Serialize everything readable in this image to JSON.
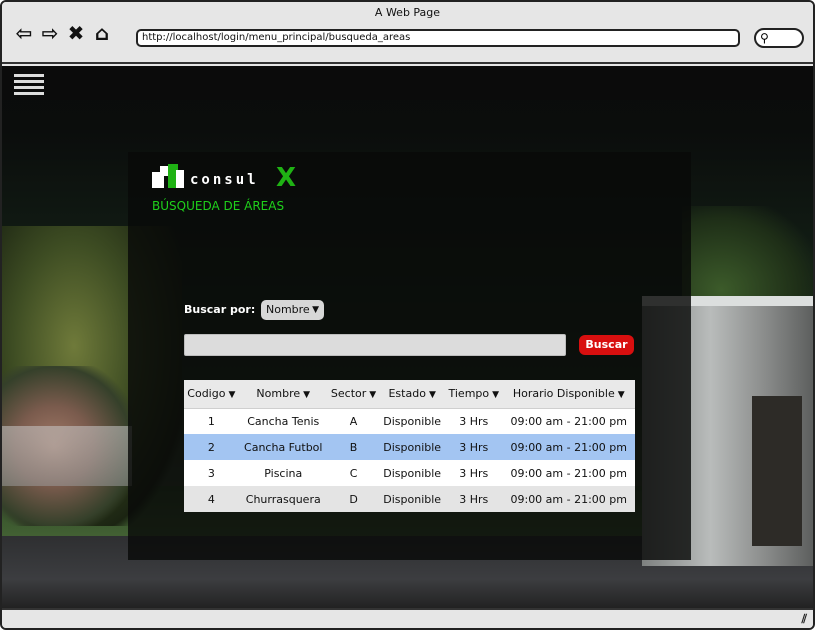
{
  "window": {
    "title": "A Web Page",
    "url": "http://localhost/login/menu_principal/busqueda_areas"
  },
  "icons": {
    "back": "back-arrow-icon",
    "forward": "forward-arrow-icon",
    "close": "close-icon",
    "home": "home-icon",
    "search": "search-icon",
    "menu": "hamburger-menu-icon",
    "resize": "resize-grip-icon"
  },
  "brand": {
    "logo_text": "consul",
    "logo_x": "X",
    "accent_color": "#1fb214"
  },
  "page": {
    "heading": "BÚSQUEDA DE ÁREAS"
  },
  "search": {
    "label": "Buscar por:",
    "filter_selected": "Nombre",
    "input_value": "",
    "button_label": "Buscar",
    "button_color": "#d80f0f"
  },
  "table": {
    "columns": [
      "Codigo",
      "Nombre",
      "Sector",
      "Estado",
      "Tiempo",
      "Horario Disponible"
    ],
    "rows": [
      [
        "1",
        "Cancha Tenis",
        "A",
        "Disponible",
        "3 Hrs",
        "09:00 am - 21:00 pm"
      ],
      [
        "2",
        "Cancha Futbol",
        "B",
        "Disponible",
        "3 Hrs",
        "09:00 am - 21:00 pm"
      ],
      [
        "3",
        "Piscina",
        "C",
        "Disponible",
        "3 Hrs",
        "09:00 am - 21:00 pm"
      ],
      [
        "4",
        "Churrasquera",
        "D",
        "Disponible",
        "3 Hrs",
        "09:00 am - 21:00 pm"
      ]
    ],
    "selected_row": 2,
    "selected_color": "#a3c5f2"
  }
}
